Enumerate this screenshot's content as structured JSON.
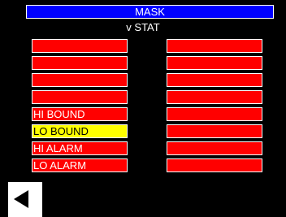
{
  "header": {
    "title": "MASK",
    "subtitle": "v STAT"
  },
  "left_column": [
    {
      "label": "",
      "state": "off"
    },
    {
      "label": "",
      "state": "off"
    },
    {
      "label": "",
      "state": "off"
    },
    {
      "label": "",
      "state": "off"
    },
    {
      "label": "HI BOUND",
      "state": "off"
    },
    {
      "label": "LO BOUND",
      "state": "on"
    },
    {
      "label": "HI ALARM",
      "state": "off"
    },
    {
      "label": "LO ALARM",
      "state": "off"
    }
  ],
  "right_column": [
    {
      "label": "",
      "state": "off"
    },
    {
      "label": "",
      "state": "off"
    },
    {
      "label": "",
      "state": "off"
    },
    {
      "label": "",
      "state": "off"
    },
    {
      "label": "",
      "state": "off"
    },
    {
      "label": "",
      "state": "off"
    },
    {
      "label": "",
      "state": "off"
    },
    {
      "label": "",
      "state": "off"
    }
  ],
  "colors": {
    "title_bg": "#0000ff",
    "cell_off": "#ff0000",
    "cell_on": "#ffff00",
    "background": "#000000"
  },
  "icons": {
    "back": "back-arrow-icon"
  }
}
